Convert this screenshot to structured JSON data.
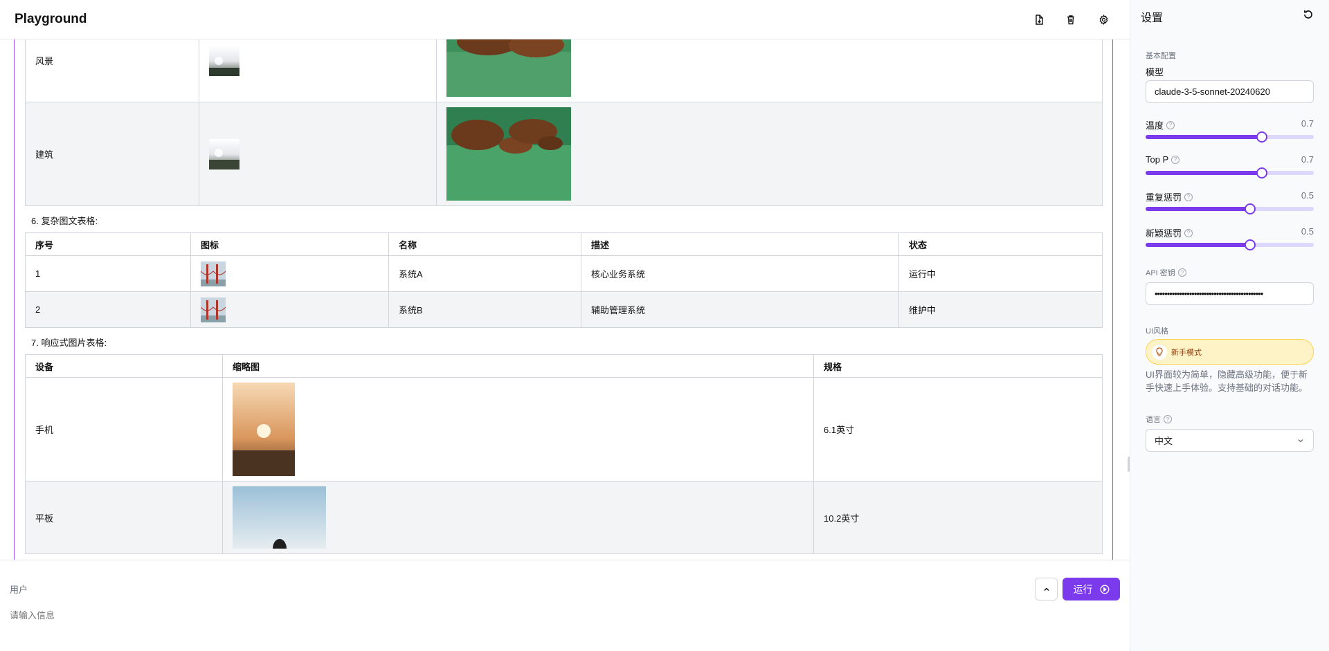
{
  "header": {
    "title": "Playground"
  },
  "gallery": {
    "rows": [
      {
        "label": "风景"
      },
      {
        "label": "建筑"
      }
    ]
  },
  "section6": {
    "title": "6. 复杂图文表格:",
    "headers": [
      "序号",
      "图标",
      "名称",
      "描述",
      "状态"
    ],
    "rows": [
      {
        "no": "1",
        "name": "系统A",
        "desc": "核心业务系统",
        "status": "运行中"
      },
      {
        "no": "2",
        "name": "系统B",
        "desc": "辅助管理系统",
        "status": "维护中"
      }
    ]
  },
  "section7": {
    "title": "7. 响应式图片表格:",
    "headers": [
      "设备",
      "缩略图",
      "规格"
    ],
    "rows": [
      {
        "device": "手机",
        "spec": "6.1英寸"
      },
      {
        "device": "平板",
        "spec": "10.2英寸"
      }
    ]
  },
  "composer": {
    "role": "用户",
    "placeholder": "请输入信息",
    "run_label": "运行"
  },
  "settings": {
    "title": "设置",
    "basic_section": "基本配置",
    "model_label": "模型",
    "model_value": "claude-3-5-sonnet-20240620",
    "sliders": [
      {
        "label": "温度",
        "value": "0.7",
        "fraction": 0.69
      },
      {
        "label": "Top P",
        "value": "0.7",
        "fraction": 0.69
      },
      {
        "label": "重复惩罚",
        "value": "0.5",
        "fraction": 0.62
      },
      {
        "label": "新颖惩罚",
        "value": "0.5",
        "fraction": 0.62
      }
    ],
    "api_key_label": "API 密钥",
    "api_key_value": "••••••••••••••••••••••••••••••••••••••••••••",
    "ui_style_label": "UI风格",
    "ui_mode": "新手模式",
    "ui_mode_desc": "UI界面较为简单，隐藏高级功能，便于新手快速上手体验。支持基础的对话功能。",
    "language_label": "语言",
    "language_value": "中文"
  },
  "colors": {
    "accent": "#7c3aed",
    "border_highlight": "#a855f7",
    "mode_bg": "#fef3c7"
  }
}
